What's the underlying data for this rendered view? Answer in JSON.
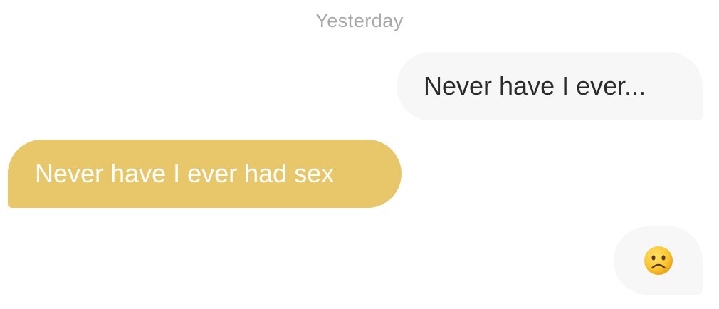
{
  "conversation": {
    "date_divider": "Yesterday",
    "messages": [
      {
        "direction": "outgoing",
        "text": "Never have I ever..."
      },
      {
        "direction": "incoming",
        "text": "Never have I ever had sex"
      },
      {
        "direction": "outgoing",
        "emoji": "frowning-face-icon"
      }
    ]
  },
  "colors": {
    "incoming_bubble": "#e8c66a",
    "outgoing_bubble": "#f7f7f7",
    "timestamp_text": "#a8a8a8"
  }
}
